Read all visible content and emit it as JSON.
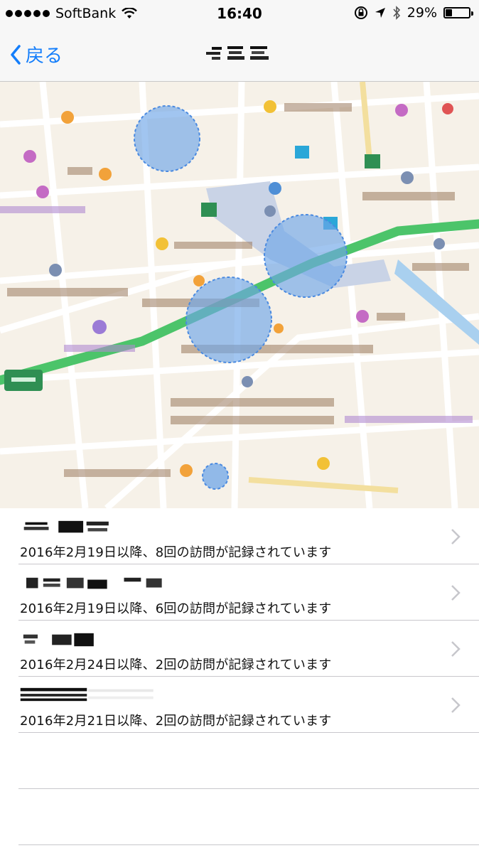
{
  "status_bar": {
    "carrier": "SoftBank",
    "time": "16:40",
    "battery": "29%",
    "battery_level": 0.29,
    "icons": [
      "signal-dots-icon",
      "wifi-icon",
      "rotation-lock-icon",
      "location-arrow-icon",
      "bluetooth-icon",
      "battery-icon"
    ]
  },
  "nav": {
    "back_label": "戻る",
    "back_icon": "chevron-left-icon",
    "title_redacted": true,
    "accent": "#147efb"
  },
  "map": {
    "type": "map",
    "route_color": "#4cc46a",
    "visit_circle_color": "#6fa6e8",
    "background": "#f6f1e8"
  },
  "locations": [
    {
      "name_redacted": true,
      "subtitle": "2016年2月19日以降、8回の訪問が記録されています"
    },
    {
      "name_redacted": true,
      "subtitle": "2016年2月19日以降、6回の訪問が記録されています"
    },
    {
      "name_redacted": true,
      "subtitle": "2016年2月24日以降、2回の訪問が記録されています"
    },
    {
      "name_redacted": true,
      "subtitle": "2016年2月21日以降、2回の訪問が記録されています"
    }
  ]
}
